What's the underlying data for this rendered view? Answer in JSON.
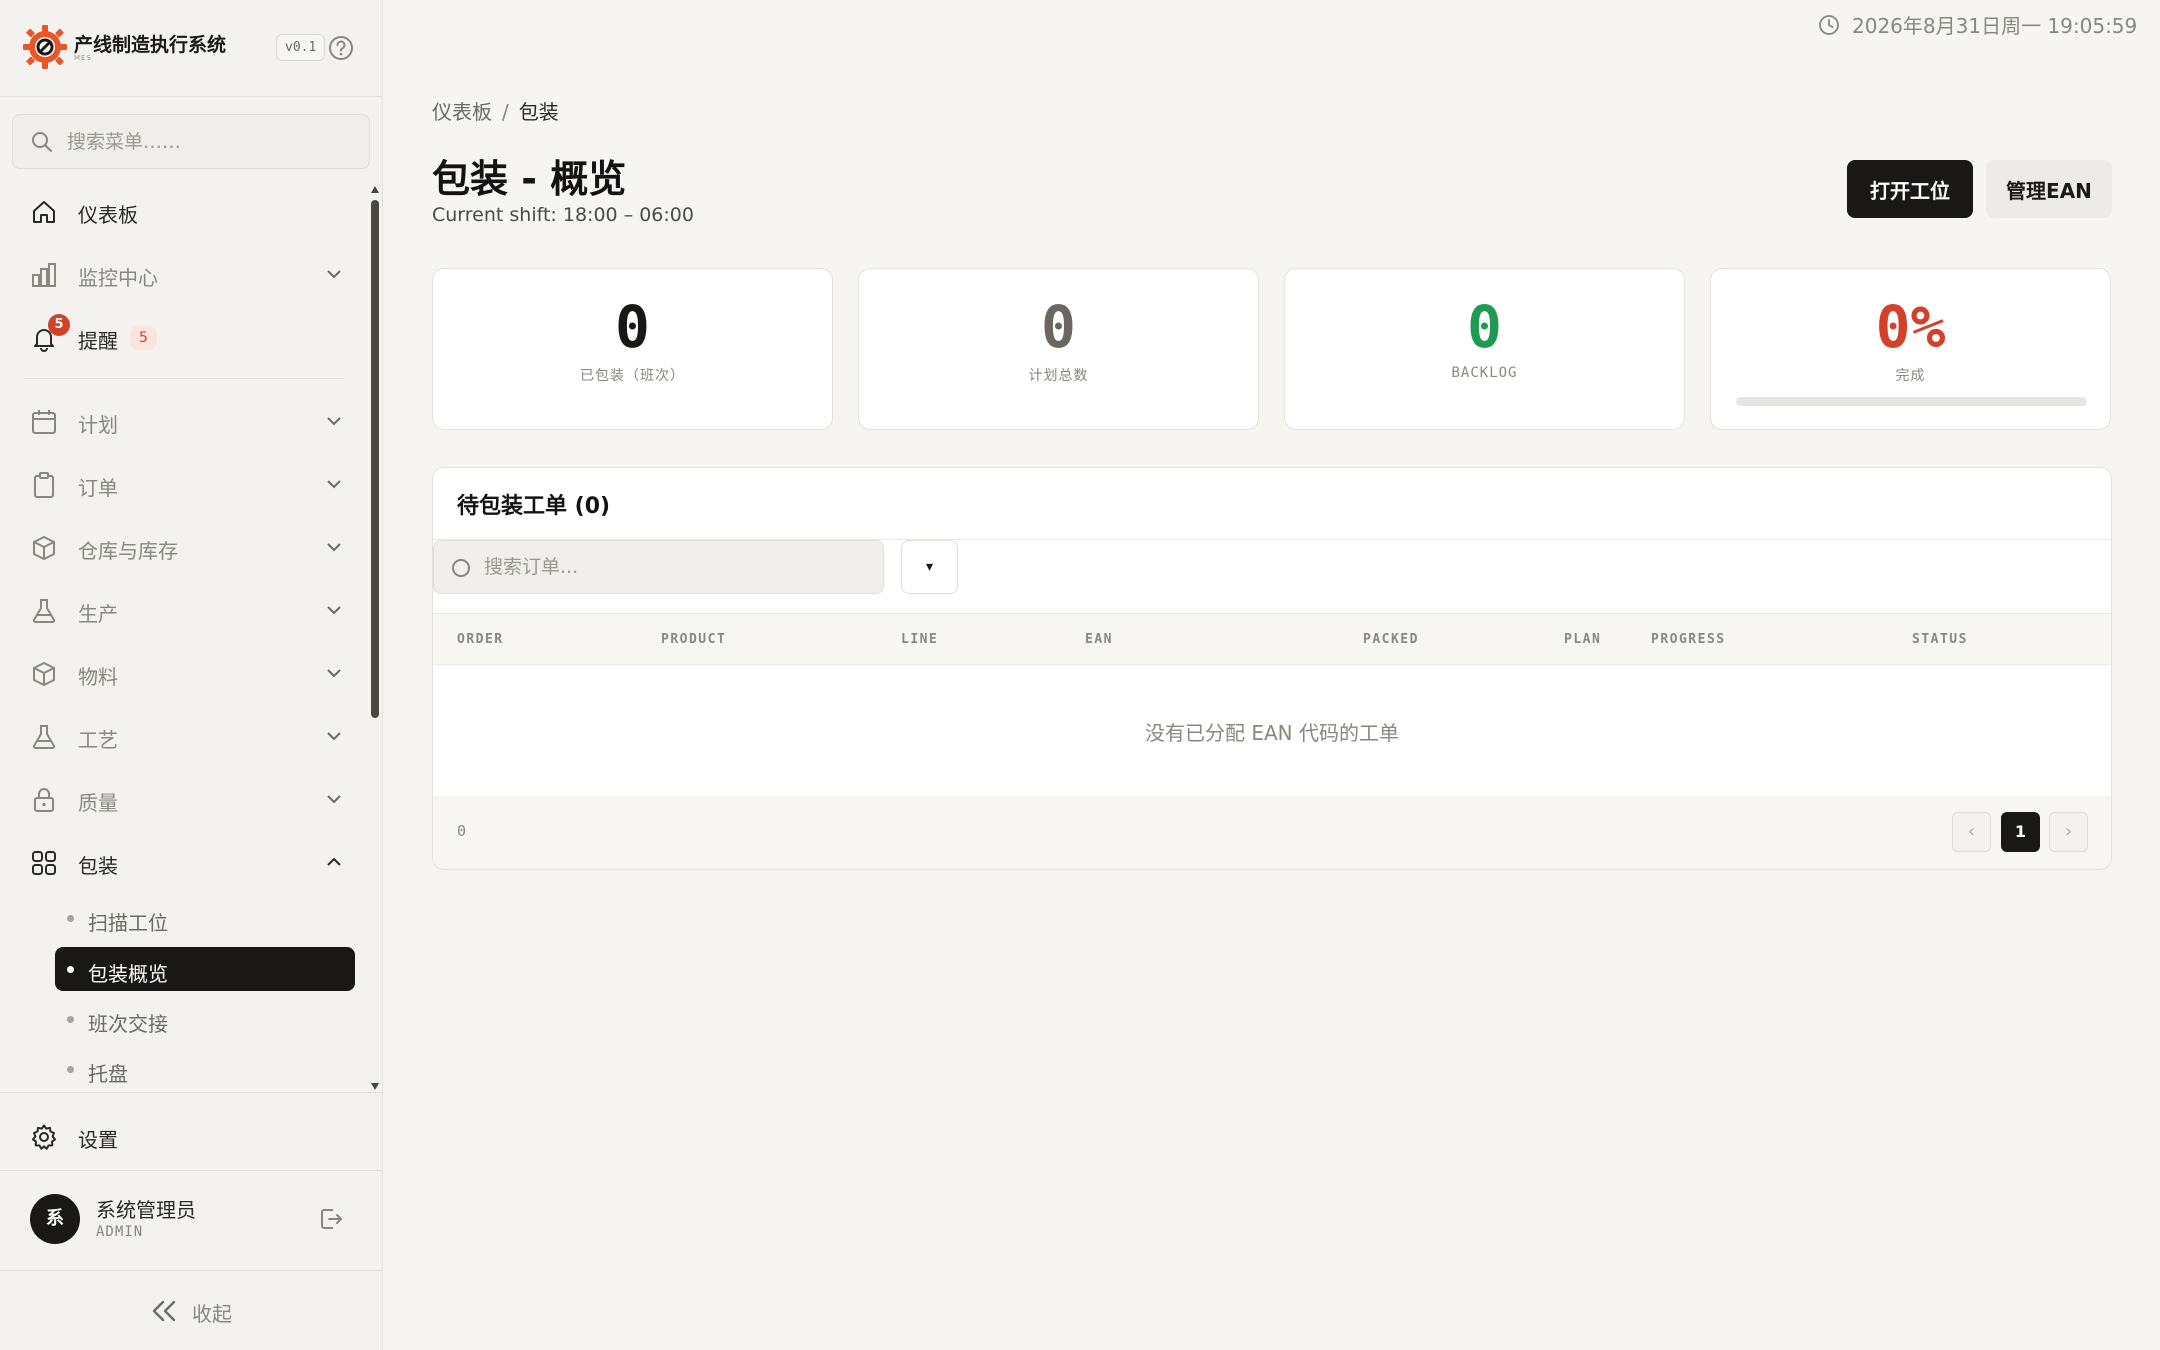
{
  "app": {
    "title": "产线制造执行系统",
    "subtitle": "MES",
    "version": "v0.1"
  },
  "sidebar": {
    "search_placeholder": "搜索菜单……",
    "top_items": [
      {
        "label": "仪表板",
        "icon": "home-icon"
      },
      {
        "label": "监控中心",
        "icon": "bar-chart-icon"
      },
      {
        "label": "提醒",
        "icon": "bell-icon",
        "badge": "5",
        "count": "5"
      }
    ],
    "items": [
      {
        "label": "计划",
        "icon": "calendar-icon"
      },
      {
        "label": "订单",
        "icon": "clipboard-icon"
      },
      {
        "label": "仓库与库存",
        "icon": "box-icon"
      },
      {
        "label": "生产",
        "icon": "flask-icon"
      },
      {
        "label": "物料",
        "icon": "box-icon"
      },
      {
        "label": "工艺",
        "icon": "flask-icon"
      },
      {
        "label": "质量",
        "icon": "lock-icon"
      },
      {
        "label": "包装",
        "icon": "grid-icon"
      }
    ],
    "sub_items": [
      {
        "label": "扫描工位",
        "active": false
      },
      {
        "label": "包装概览",
        "active": true
      },
      {
        "label": "班次交接",
        "active": false
      },
      {
        "label": "托盘",
        "active": false
      }
    ],
    "settings_label": "设置",
    "user": {
      "avatar": "系",
      "name": "系统管理员",
      "role": "ADMIN"
    },
    "collapse_label": "收起"
  },
  "header": {
    "datetime": "2026年8月31日周一 19:05:59"
  },
  "breadcrumb": {
    "root": "仪表板",
    "separator": "/",
    "current": "包装"
  },
  "page": {
    "title": "包装 - 概览",
    "shift": "Current shift: 18:00 – 06:00",
    "actions": {
      "open_station": "打开工位",
      "manage_ean": "管理EAN"
    }
  },
  "stats": [
    {
      "value": "0",
      "label": "已包装（班次）",
      "color": "#1a1816"
    },
    {
      "value": "0",
      "label": "计划总数",
      "color": "#6b675f"
    },
    {
      "value": "0",
      "label": "BACKLOG",
      "color": "#1f9a53"
    },
    {
      "value": "0%",
      "label": "完成",
      "color": "#d4412b",
      "progress": 0
    }
  ],
  "table": {
    "title": "待包装工单 (0)",
    "search_placeholder": "搜索订单...",
    "filter_label": "▾",
    "columns": [
      "ORDER",
      "PRODUCT",
      "LINE",
      "EAN",
      "PACKED",
      "PLAN",
      "PROGRESS",
      "STATUS"
    ],
    "empty_text": "没有已分配 EAN 代码的工单",
    "total": "0",
    "pagination": {
      "prev": "‹",
      "page": "1",
      "next": "›"
    }
  },
  "colors": {
    "accent_dark": "#1a1816",
    "danger": "#d4412b",
    "success": "#1f9a53",
    "background": "#f6f5f2"
  }
}
